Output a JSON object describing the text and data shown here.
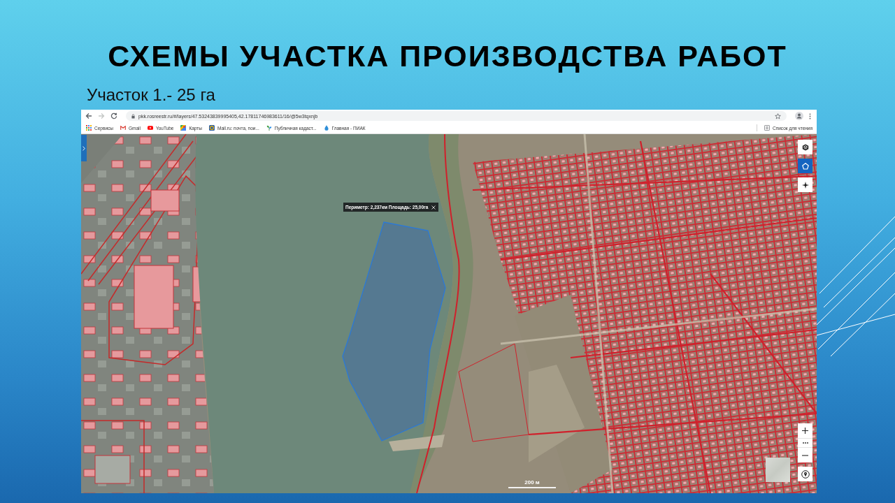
{
  "slide": {
    "title": "СХЕМЫ УЧАСТКА ПРОИЗВОДСТВА РАБОТ",
    "subtitle": "Участок 1.- 25 га"
  },
  "browser": {
    "nav": [
      {
        "kind": "back",
        "disabled": false
      },
      {
        "kind": "forward",
        "disabled": true
      },
      {
        "kind": "reload",
        "disabled": false
      }
    ],
    "url": "pkk.rosreestr.ru/#/layers/47.53243839995405,42.17811746983611/16/@5w3tqxnjb",
    "bookmarks": [
      {
        "kind": "apps",
        "label": "Сервисы"
      },
      {
        "kind": "envelope",
        "label": "Gmail"
      },
      {
        "kind": "video",
        "label": "YouTube"
      },
      {
        "kind": "map",
        "label": "Карты"
      },
      {
        "kind": "portal",
        "label": "Mail.ru: почта, пои..."
      },
      {
        "kind": "cadastre",
        "label": "Публичная кадаст..."
      },
      {
        "kind": "drop",
        "label": "Главная - ПИАК"
      }
    ],
    "reading_list": "Список для чтения"
  },
  "map": {
    "tools": [
      {
        "kind": "layers",
        "selected": false
      },
      {
        "kind": "area",
        "selected": true
      },
      {
        "kind": "locate",
        "selected": false
      }
    ],
    "measurement": "Периметр: 2,237км Площадь: 25,00га",
    "scale": "200 м"
  }
}
